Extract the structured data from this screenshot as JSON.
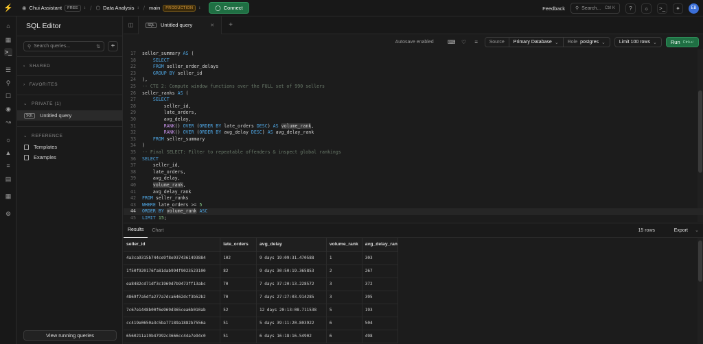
{
  "topbar": {
    "org": "Chui Assistant",
    "org_badge": "FREE",
    "project": "Data Analysis",
    "branch": "main",
    "branch_badge": "PRODUCTION",
    "connect": "Connect",
    "feedback": "Feedback",
    "search_placeholder": "Search...",
    "search_shortcut": "Ctrl K",
    "avatar_initials": "EB"
  },
  "sidebar": {
    "title": "SQL Editor",
    "search_placeholder": "Search queries...",
    "shared": "SHARED",
    "favorites": "FAVORITES",
    "private": "PRIVATE (1)",
    "private_item": "Untitled query",
    "private_item_tag": "SQL",
    "reference": "REFERENCE",
    "templates": "Templates",
    "examples": "Examples",
    "view_running": "View running queries"
  },
  "tabs": {
    "active": "Untitled query"
  },
  "toolbar": {
    "autosave": "Autosave enabled",
    "source_label": "Source",
    "source_value": "Primary Database",
    "role_label": "Role",
    "role_value": "postgres",
    "limit": "Limit 100 rows",
    "run": "Run",
    "run_shortcut": "Ctrl+↵"
  },
  "editor": {
    "lines": [
      {
        "n": "17",
        "code": "seller_summary AS ("
      },
      {
        "n": "18",
        "code": "    SELECT"
      },
      {
        "n": "22",
        "code": "    FROM seller_order_delays"
      },
      {
        "n": "23",
        "code": "    GROUP BY seller_id"
      },
      {
        "n": "24",
        "code": "),"
      },
      {
        "n": "25",
        "code": "-- CTE 2: Compute window functions over the FULL set of 990 sellers"
      },
      {
        "n": "26",
        "code": "seller_ranks AS ("
      },
      {
        "n": "27",
        "code": "    SELECT"
      },
      {
        "n": "28",
        "code": "        seller_id,"
      },
      {
        "n": "29",
        "code": "        late_orders,"
      },
      {
        "n": "30",
        "code": "        avg_delay,"
      },
      {
        "n": "31",
        "code": "        RANK() OVER (ORDER BY late_orders DESC) AS volume_rank,"
      },
      {
        "n": "32",
        "code": "        RANK() OVER (ORDER BY avg_delay DESC) AS avg_delay_rank"
      },
      {
        "n": "33",
        "code": "    FROM seller_summary"
      },
      {
        "n": "34",
        "code": ")"
      },
      {
        "n": "35",
        "code": "-- Final SELECT: Filter to repeatable offenders & inspect global rankings"
      },
      {
        "n": "36",
        "code": "SELECT"
      },
      {
        "n": "37",
        "code": "    seller_id,"
      },
      {
        "n": "38",
        "code": "    late_orders,"
      },
      {
        "n": "39",
        "code": "    avg_delay,"
      },
      {
        "n": "40",
        "code": "    volume_rank,"
      },
      {
        "n": "41",
        "code": "    avg_delay_rank"
      },
      {
        "n": "42",
        "code": "FROM seller_ranks"
      },
      {
        "n": "43",
        "code": "WHERE late_orders >= 5"
      },
      {
        "n": "44",
        "code": "ORDER BY volume_rank ASC"
      },
      {
        "n": "45",
        "code": "LIMIT 15;"
      }
    ]
  },
  "results": {
    "tab_results": "Results",
    "tab_chart": "Chart",
    "row_count": "15 rows",
    "export": "Export",
    "columns": [
      "seller_id",
      "late_orders",
      "avg_delay",
      "volume_rank",
      "avg_delay_ran"
    ],
    "rows": [
      [
        "4a3ca9315b744ce9f8e9374361493884",
        "102",
        "9 days 19:09:31.470588",
        "1",
        "303"
      ],
      [
        "1f50f920176fa81dab994f9023523100",
        "82",
        "9 days 30:50:19.365853",
        "2",
        "267"
      ],
      [
        "ea8482cd71df3c1969d7b9473ff13abc",
        "70",
        "7 days 37:20:13.228572",
        "3",
        "372"
      ],
      [
        "4869f7a5dfa277a7dca6462dcf3b52b2",
        "70",
        "7 days 27:27:03.914285",
        "3",
        "395"
      ],
      [
        "7c67e1448b00f6e969d365cea6b010ab",
        "52",
        "12 days 20:13:08.711538",
        "5",
        "193"
      ],
      [
        "cc419e0650a3c5ba77189a1882b7556a",
        "51",
        "5 days 39:11:20.803922",
        "6",
        "504"
      ],
      [
        "6560211a19b47992c3666cc44a7e94c0",
        "51",
        "6 days 16:18:16.54902",
        "6",
        "498"
      ]
    ]
  }
}
